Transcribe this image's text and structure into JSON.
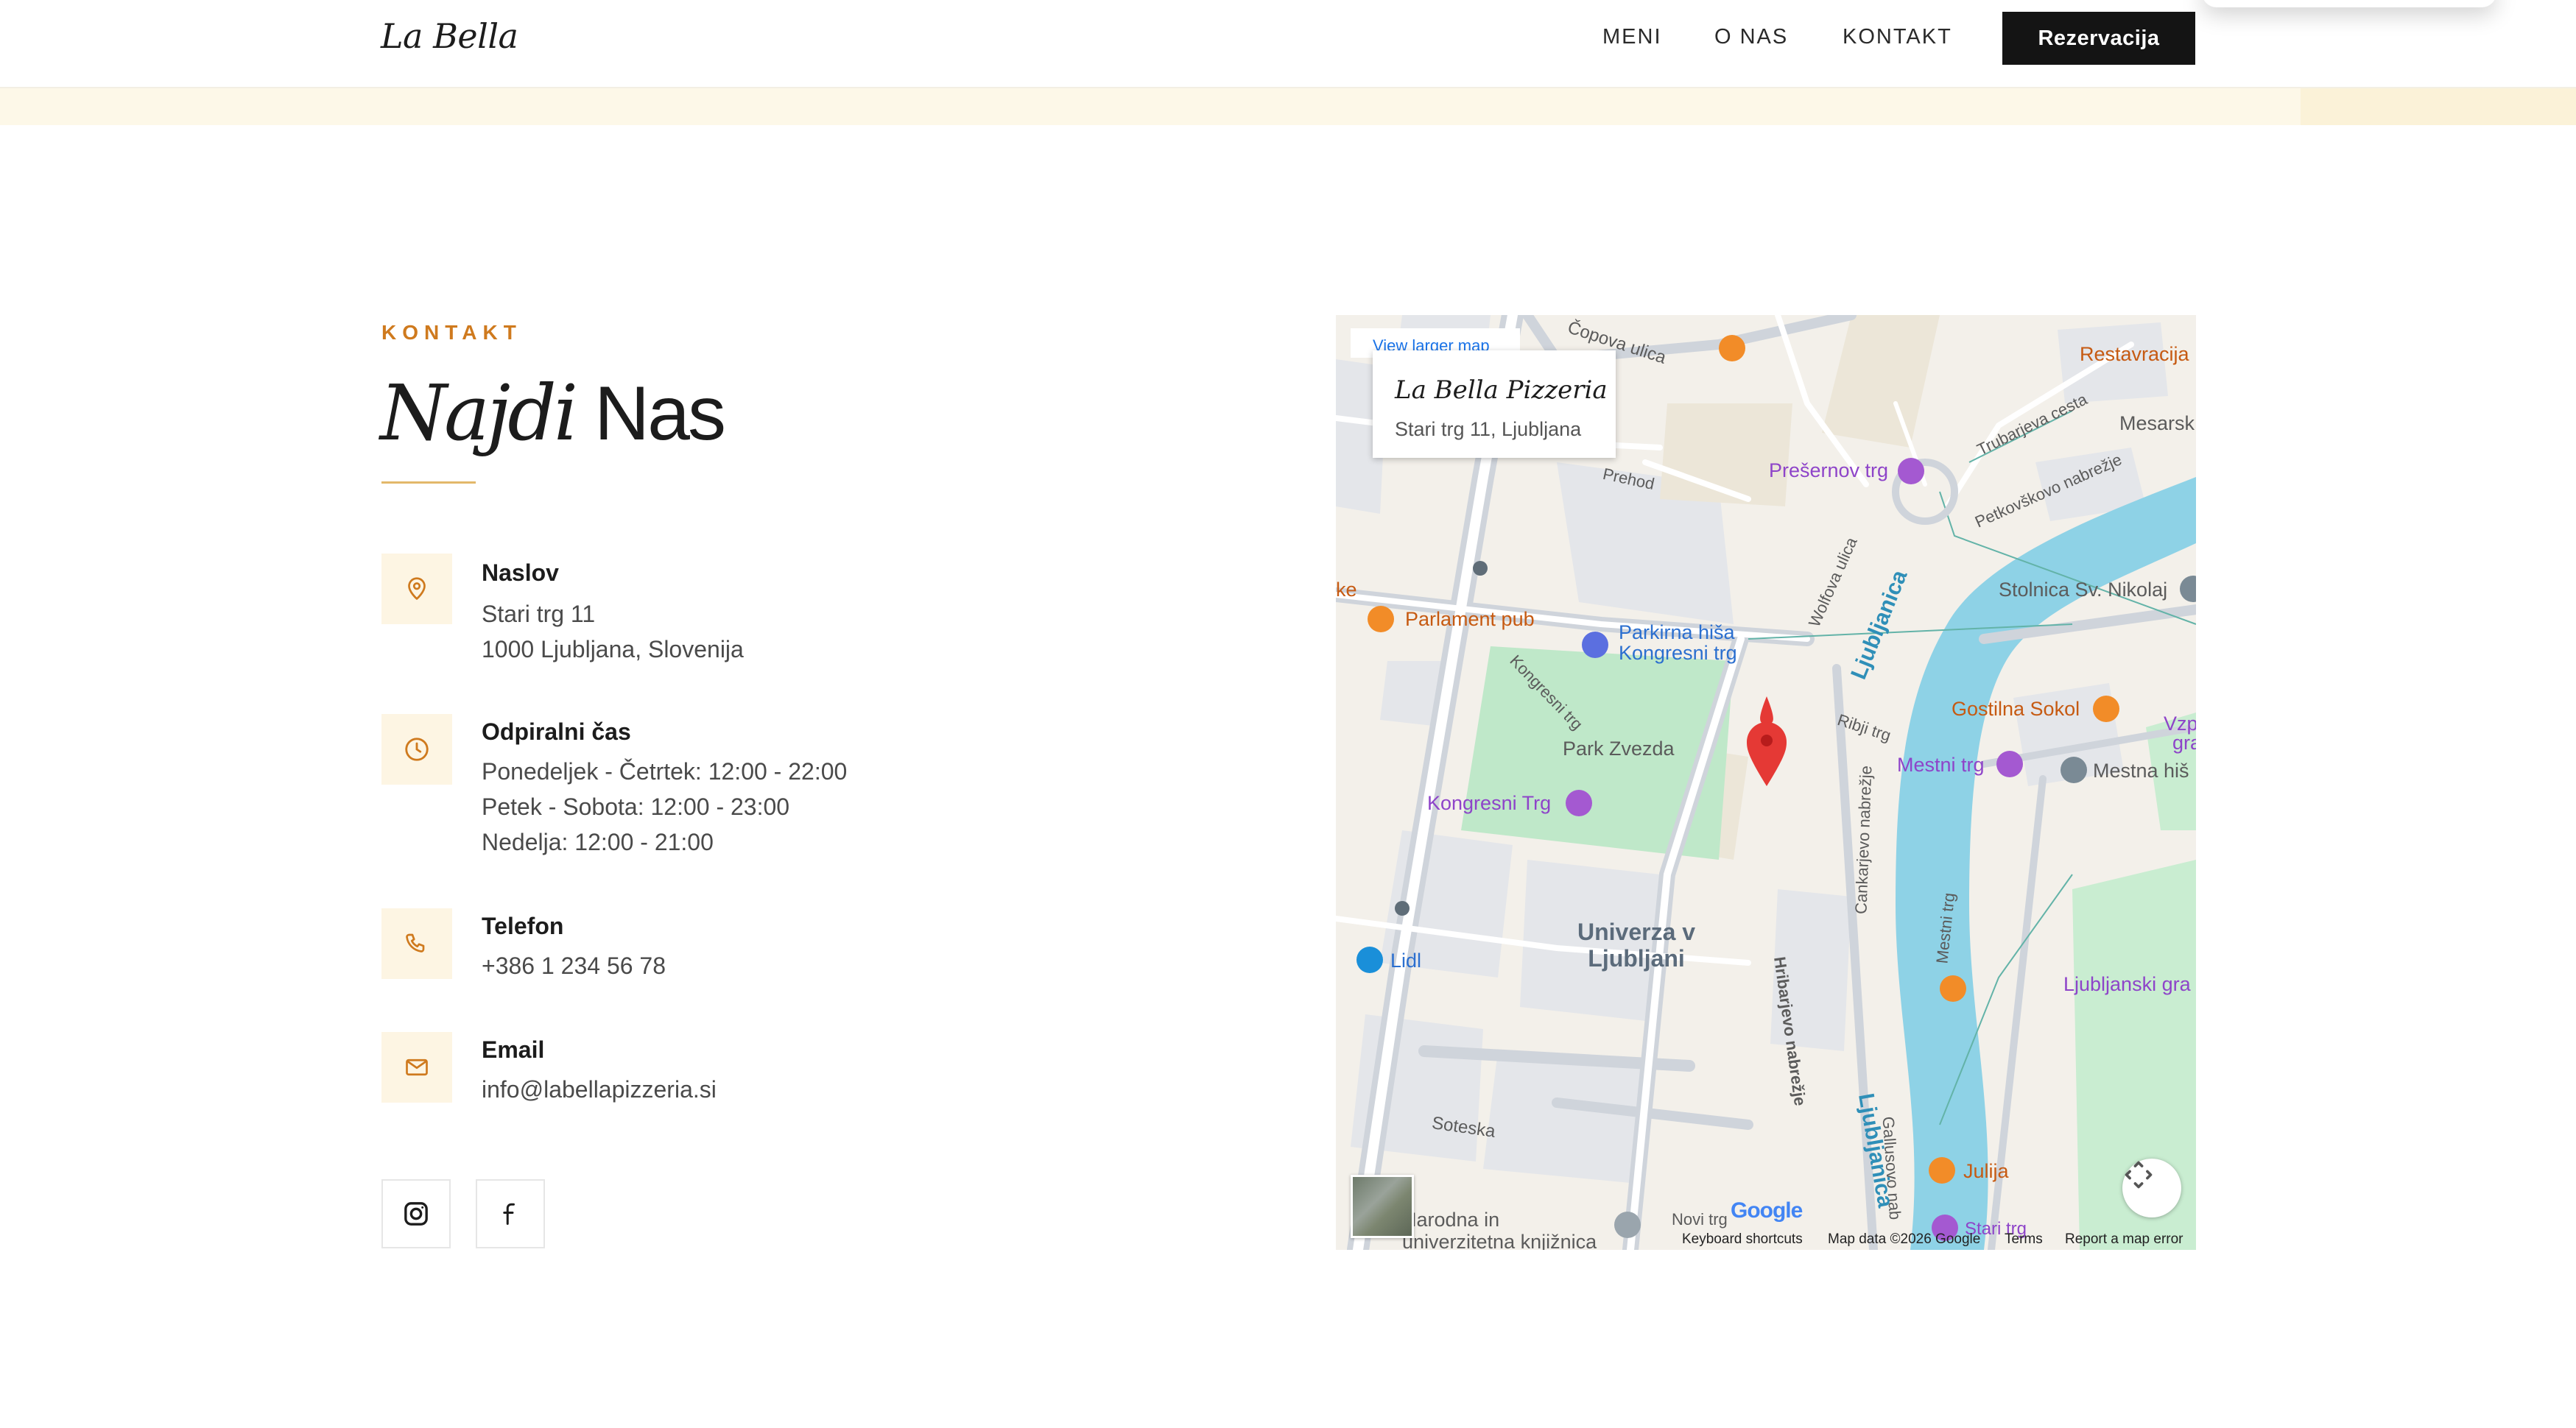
{
  "header": {
    "logo": "La Bella",
    "nav": [
      "MENI",
      "O NAS",
      "KONTAKT"
    ],
    "cta": "Rezervacija"
  },
  "contact": {
    "eyebrow": "KONTAKT",
    "title_italic": "Najdi",
    "title_regular": "Nas",
    "items": [
      {
        "icon": "map-pin-icon",
        "label": "Naslov",
        "lines": [
          "Stari trg 11",
          "1000 Ljubljana, Slovenija"
        ]
      },
      {
        "icon": "clock-icon",
        "label": "Odpiralni čas",
        "lines": [
          "Ponedeljek - Četrtek: 12:00 - 22:00",
          "Petek - Sobota: 12:00 - 23:00",
          "Nedelja: 12:00 - 21:00"
        ]
      },
      {
        "icon": "phone-icon",
        "label": "Telefon",
        "lines": [
          "+386 1 234 56 78"
        ]
      },
      {
        "icon": "mail-icon",
        "label": "Email",
        "lines": [
          "info@labellapizzeria.si"
        ]
      }
    ],
    "social": [
      "instagram-icon",
      "facebook-icon"
    ]
  },
  "map": {
    "view_larger": "View larger map",
    "card_name": "La Bella Pizzeria",
    "card_address": "Stari trg 11, Ljubljana",
    "labels": {
      "copova": "Čopova ulica",
      "restavracija": "Restavracija",
      "mesarski": "Mesarsk",
      "trubarjeva": "Trubarjeva cesta",
      "presernov": "Prešernov trg",
      "petkovskovo": "Petkovškovo nabrežje",
      "prehod": "Prehod",
      "stolnica": "Stolnica Sv. Nikolaj",
      "ke": "ke",
      "parlament": "Parlament pub",
      "parkirna": "Parkirna hiša",
      "kongresni_trg_parking": "Kongresni trg",
      "wolfova": "Wolfova ulica",
      "ljubljanica": "Ljubljanica",
      "kongresni_trg_street": "Kongresni trg",
      "ribji": "Ribji trg",
      "gostilna": "Gostilna Sokol",
      "vzp": "Vzp",
      "gra": "gra",
      "park_zvezda": "Park Zvezda",
      "mestni": "Mestni trg",
      "mestna": "Mestna hiš",
      "kongresni_trg_poi": "Kongresni Trg",
      "cankarjevo": "Cankarjevo nabrežje",
      "univerza": "Univerza v\nLjubljani",
      "lidl": "Lidl",
      "hribarjevo": "Hribarjevo nabrežje",
      "mestni_trg_street": "Mestni trg",
      "ljubljanski_grad": "Ljubljanski gra",
      "soteska": "Soteska",
      "gallusovo": "Gallusovo nab",
      "julija": "Julija",
      "narodna": "Narodna in\nuniverzitetna knjižnica",
      "novi_trg": "Novi trg",
      "stari_trg": "Stari trg"
    },
    "google": "Google",
    "attribution": [
      "Keyboard shortcuts",
      "Map data ©2026 Google",
      "Terms",
      "Report a map error"
    ]
  },
  "colors": {
    "accent": "#cf7a1e",
    "cream": "#fdf5e3",
    "park": "#bfe8c9",
    "water": "#8ed2e6",
    "pin": "#e53935"
  }
}
